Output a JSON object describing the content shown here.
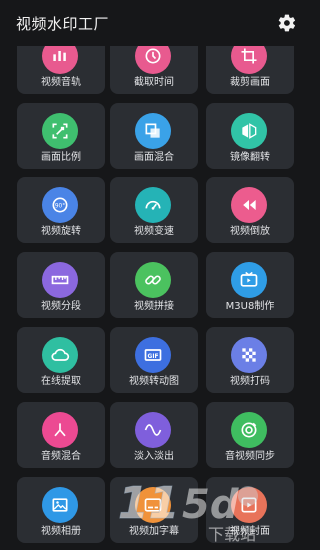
{
  "app_title": "视频水印工厂",
  "rows": [
    [
      {
        "label": "视频音轨",
        "icon": "audio-track-icon",
        "color": "#e85a8f"
      },
      {
        "label": "截取时间",
        "icon": "clock-icon",
        "color": "#e85a8f"
      },
      {
        "label": "裁剪画面",
        "icon": "crop-icon",
        "color": "#e85a8f"
      }
    ],
    [
      {
        "label": "画面比例",
        "icon": "aspect-ratio-icon",
        "color": "#3fbf6f"
      },
      {
        "label": "画面混合",
        "icon": "layers-icon",
        "color": "#3aa2e8"
      },
      {
        "label": "镜像翻转",
        "icon": "mirror-icon",
        "color": "#31c4a7"
      }
    ],
    [
      {
        "label": "视频旋转",
        "icon": "rotate-90-icon",
        "color": "#4a84e6"
      },
      {
        "label": "视频变速",
        "icon": "speedometer-icon",
        "color": "#25b3b6"
      },
      {
        "label": "视频倒放",
        "icon": "rewind-icon",
        "color": "#ec5c8e"
      }
    ],
    [
      {
        "label": "视频分段",
        "icon": "ruler-icon",
        "color": "#8b68df"
      },
      {
        "label": "视频拼接",
        "icon": "link-icon",
        "color": "#4bc25f"
      },
      {
        "label": "M3U8制作",
        "icon": "tv-icon",
        "color": "#2f9de6"
      }
    ],
    [
      {
        "label": "在线提取",
        "icon": "cloud-icon",
        "color": "#2fbfa1"
      },
      {
        "label": "视频转动图",
        "icon": "gif-icon",
        "color": "#3d6fe0"
      },
      {
        "label": "视频打码",
        "icon": "mosaic-icon",
        "color": "#6b7fe6"
      }
    ],
    [
      {
        "label": "音频混合",
        "icon": "merge-icon",
        "color": "#ec4a92"
      },
      {
        "label": "淡入淡出",
        "icon": "wave-icon",
        "color": "#7f5fdc"
      },
      {
        "label": "音视频同步",
        "icon": "sync-icon",
        "color": "#3fbd60"
      }
    ],
    [
      {
        "label": "视频相册",
        "icon": "photo-album-icon",
        "color": "#2f98e6"
      },
      {
        "label": "视频加字幕",
        "icon": "subtitle-icon",
        "color": "#f0923a"
      },
      {
        "label": "视频封面",
        "icon": "cover-icon",
        "color": "#e8735a"
      }
    ]
  ],
  "watermark": {
    "brand": "11",
    "site": "下载站"
  }
}
